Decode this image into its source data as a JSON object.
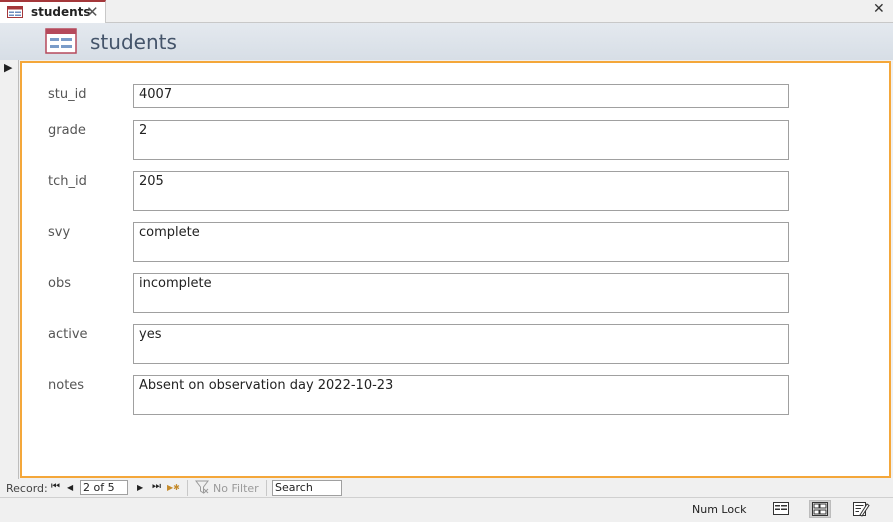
{
  "tab": {
    "title": "students",
    "close_glyph": "✕",
    "icon": "form-icon"
  },
  "window": {
    "close_glyph": "✕"
  },
  "header": {
    "title": "students",
    "icon": "form-icon"
  },
  "record_selector": {
    "glyph": "▶"
  },
  "fields": [
    {
      "label": "stu_id",
      "value": "4007"
    },
    {
      "label": "grade",
      "value": "2"
    },
    {
      "label": "tch_id",
      "value": "205"
    },
    {
      "label": "svy",
      "value": "complete"
    },
    {
      "label": "obs",
      "value": "incomplete"
    },
    {
      "label": "active",
      "value": "yes"
    },
    {
      "label": "notes",
      "value": "Absent on observation day 2022-10-23"
    }
  ],
  "navigation": {
    "record_label": "Record:",
    "first_glyph": "⏮",
    "prev_glyph": "◀",
    "position": "2 of 5",
    "next_glyph": "▶",
    "last_glyph": "⏭",
    "new_glyph": "▶✱",
    "filter_label": "No Filter",
    "filter_icon": "funnel-icon",
    "search_placeholder": "Search"
  },
  "status": {
    "numlock": "Num Lock",
    "views": [
      "form-view-icon",
      "layout-view-icon",
      "design-view-icon"
    ]
  },
  "colors": {
    "accent_border": "#f4a73a",
    "tab_accent": "#a4373a",
    "header_text": "#44546a"
  }
}
